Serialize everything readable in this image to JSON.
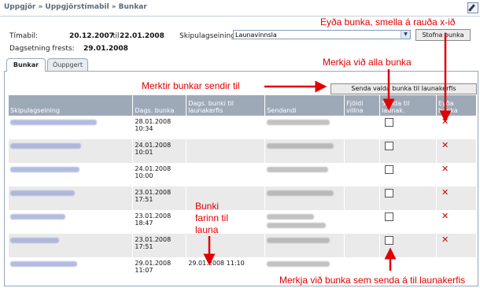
{
  "breadcrumb": "Uppgjör » Uppgjörstímabil » Bunkar",
  "form": {
    "timabil_label": "Tímabil:",
    "timabil_from": "20.12.2007",
    "til_label": "til",
    "timabil_to": "22.01.2008",
    "skipulag_label": "Skipulagseining",
    "skipulag_value": "Launavinnsla",
    "stofna_button": "Stofna bunka",
    "frestur_label": "Dagsetning frests:",
    "frestur_value": "29.01.2008"
  },
  "tabs": [
    {
      "label": "Bunkar",
      "active": true
    },
    {
      "label": "Óuppgert",
      "active": false
    }
  ],
  "send_button": "Senda valda bunka til launakerfis",
  "columns": [
    "Skipulagseining",
    "Dags. bunka",
    "Dags. bunki til launakerfis",
    "Sendandi",
    "Fjöldi villna",
    "Senda til launak.",
    "Eyða bunka"
  ],
  "rows": [
    {
      "date": "28.01.2008",
      "time": "10:34",
      "sent": "",
      "checkbox": true,
      "delete": true
    },
    {
      "date": "24.01.2008",
      "time": "10:01",
      "sent": "",
      "checkbox": true,
      "delete": true
    },
    {
      "date": "24.01.2008",
      "time": "10:00",
      "sent": "",
      "checkbox": true,
      "delete": true
    },
    {
      "date": "23.01.2008",
      "time": "17:51",
      "sent": "",
      "checkbox": true,
      "delete": true
    },
    {
      "date": "23.01.2008",
      "time": "18:47",
      "sent": "",
      "checkbox": true,
      "delete": true
    },
    {
      "date": "23.01.2008",
      "time": "17:51",
      "sent": "",
      "checkbox": true,
      "delete": true
    },
    {
      "date": "29.01.2008",
      "time": "11:07",
      "sent": "29.01.2008 11:10",
      "checkbox": false,
      "delete": false
    }
  ],
  "annotations": {
    "delete_hint": "Eyða bunka, smella á rauða x-ið",
    "select_all": "Merkja við alla bunka",
    "send_hint": "Merktir bunkar sendir til",
    "sent_hint_line1": "Bunki",
    "sent_hint_line2": "farinn til",
    "sent_hint_line3": "launa",
    "select_hint": "Merkja við bunka sem senda á til launakerfis"
  },
  "colors": {
    "header_bg": "#9ea9b8",
    "annotation": "#e00000",
    "delete_x": "#cc0000"
  }
}
